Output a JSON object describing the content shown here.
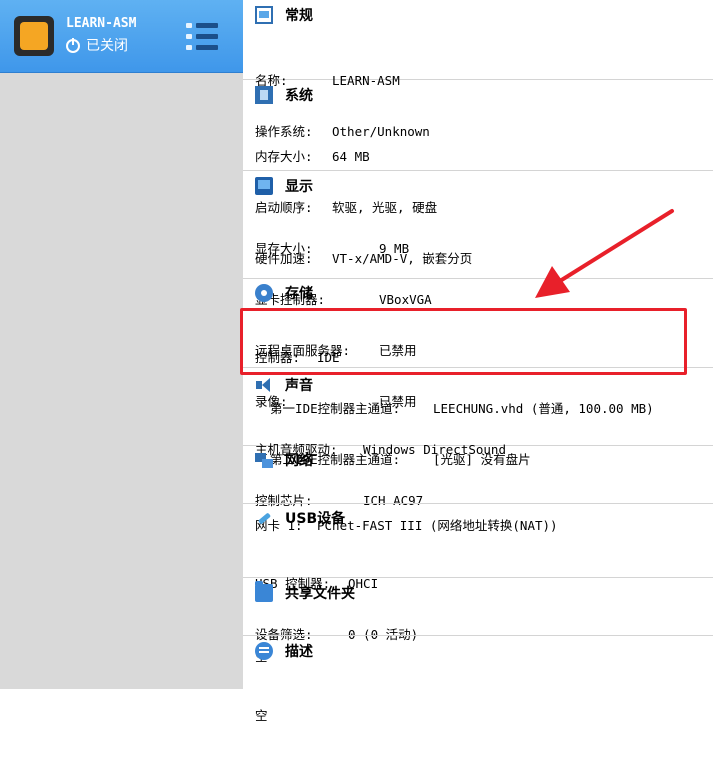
{
  "vm": {
    "name": "LEARN-ASM",
    "status": "已关闭"
  },
  "sections": {
    "general": {
      "title": "常规",
      "lines": [
        {
          "label": "名称:",
          "value": "LEARN-ASM"
        },
        {
          "label": "操作系统:",
          "value": "Other/Unknown"
        }
      ]
    },
    "system": {
      "title": "系统",
      "lines": [
        {
          "label": "内存大小:",
          "value": "64 MB"
        },
        {
          "label": "启动顺序:",
          "value": "软驱, 光驱, 硬盘"
        },
        {
          "label": "硬件加速:",
          "value": "VT-x/AMD-V, 嵌套分页"
        }
      ]
    },
    "display": {
      "title": "显示",
      "lines": [
        {
          "label": "显存大小:",
          "value": "9 MB"
        },
        {
          "label": "显卡控制器:",
          "value": "VBoxVGA"
        },
        {
          "label": "远程桌面服务器:",
          "value": "已禁用"
        },
        {
          "label": "录像:",
          "value": "已禁用"
        }
      ]
    },
    "storage": {
      "title": "存储",
      "lines": [
        {
          "label": "控制器:",
          "value": "IDE"
        },
        {
          "label": "  第一IDE控制器主通道:",
          "value": "LEECHUNG.vhd (普通, 100.00 MB)"
        },
        {
          "label": "  第二IDE控制器主通道:",
          "value": "[光驱] 没有盘片"
        }
      ]
    },
    "audio": {
      "title": "声音",
      "lines": [
        {
          "label": "主机音频驱动:",
          "value": "Windows DirectSound"
        },
        {
          "label": "控制芯片:",
          "value": "ICH AC97"
        }
      ]
    },
    "network": {
      "title": "网络",
      "lines": [
        {
          "label": "网卡 1:",
          "value": "PCnet-FAST III (网络地址转换(NAT))"
        }
      ]
    },
    "usb": {
      "title": "USB设备",
      "lines": [
        {
          "label": "USB 控制器:",
          "value": "OHCI"
        },
        {
          "label": "设备筛选:",
          "value": "0 (0 活动)"
        }
      ]
    },
    "shared_folders": {
      "title": "共享文件夹",
      "text": "空"
    },
    "description": {
      "title": "描述",
      "text": "空"
    }
  },
  "colors": {
    "selection": "#4aa0ec",
    "annotation": "#e8202a"
  },
  "icons": {
    "general": "general-settings-icon",
    "system": "chip-icon",
    "display": "monitor-icon",
    "storage": "disk-icon",
    "audio": "speaker-icon",
    "network": "network-icon",
    "usb": "usb-icon",
    "shared_folders": "folder-icon",
    "description": "speech-bubble-icon",
    "menu": "list-menu-icon",
    "power": "power-icon"
  }
}
